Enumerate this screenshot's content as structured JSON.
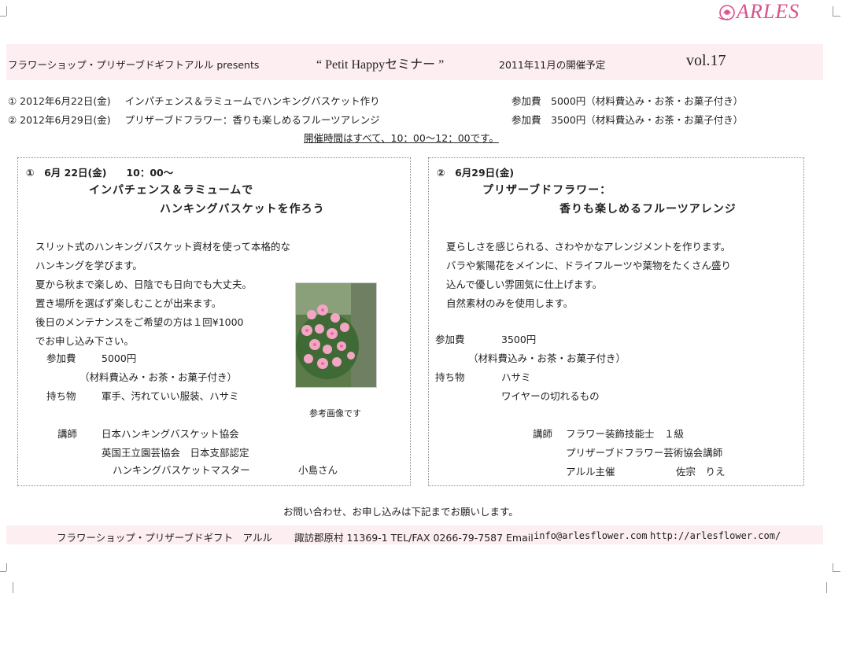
{
  "logo": {
    "text": "ARLES"
  },
  "header": {
    "shop": "フラワーショップ・プリザーブドギフトアルル presents",
    "seminar": "“ Petit Happyセミナー ”",
    "schedule_label": "2011年11月の開催予定",
    "volume": "vol.17"
  },
  "schedule": [
    {
      "date": "① 2012年6月22日(金)",
      "title": "インパチェンス＆ラミュームでハンキングバスケット作り",
      "fee": "参加費　5000円（材料費込み・お茶・お菓子付き）"
    },
    {
      "date": "② 2012年6月29日(金)",
      "title": "プリザーブドフラワー：香りも楽しめるフルーツアレンジ",
      "fee": "参加費　3500円（材料費込み・お茶・お菓子付き）"
    }
  ],
  "hours_note": "開催時間はすべて、10：00～12：00です。",
  "left_box": {
    "heading_date": "①　6月 22日(金)　　10：00～",
    "title_line1": "インパチェンス＆ラミュームで",
    "title_line2": "ハンキングバスケットを作ろう",
    "desc": [
      "スリット式のハンキングバスケット資材を使って本格的な",
      "ハンキングを学びます。",
      "夏から秋まで楽しめ、日陰でも日向でも大丈夫。",
      "置き場所を選ばず楽しむことが出来ます。",
      "後日のメンテナンスをご希望の方は１回¥1000",
      "でお申し込み下さい。"
    ],
    "fee_label": "参加費",
    "fee_value": "5000円",
    "fee_note": "（材料費込み・お茶・お菓子付き）",
    "items_label": "持ち物",
    "items_value": "軍手、汚れていい服装、ハサミ",
    "photo_caption": "参考画像です",
    "instructor_label": "講師",
    "instructor_lines": [
      "日本ハンキングバスケット協会",
      "英国王立園芸協会　日本支部認定"
    ],
    "instructor_title": "ハンキングバスケットマスター",
    "instructor_name": "小島さん"
  },
  "right_box": {
    "heading_date": "②　6月29日(金)",
    "title_line1": "プリザーブドフラワー：",
    "title_line2": "香りも楽しめるフルーツアレンジ",
    "desc": [
      "夏らしさを感じられる、さわやかなアレンジメントを作ります。",
      "バラや紫陽花をメインに、ドライフルーツや葉物をたくさん盛り",
      "込んで優しい雰囲気に仕上げます。",
      "自然素材のみを使用します。"
    ],
    "fee_label": "参加費",
    "fee_value": "3500円",
    "fee_note": "（材料費込み・お茶・お菓子付き）",
    "items_label": "持ち物",
    "items_values": [
      "ハサミ",
      "ワイヤーの切れるもの"
    ],
    "instructor_label": "講師",
    "instructor_lines": [
      "フラワー装飾技能士　１級",
      "プリザーブドフラワー芸術協会講師"
    ],
    "instructor_role": "アルル主催",
    "instructor_name": "佐宗　りえ"
  },
  "contact_note": "お問い合わせ、お申し込みは下記までお願いします。",
  "footer": {
    "shop": "フラワーショップ・プリザーブドギフト　アルル",
    "address": "諏訪郡原村 11369-1 TEL/FAX 0266-79-7587 Email",
    "email": "info@arlesflower.com",
    "url": "http://arlesflower.com/"
  },
  "colors": {
    "band": "#fdeef2",
    "logo": "#d9508a"
  }
}
